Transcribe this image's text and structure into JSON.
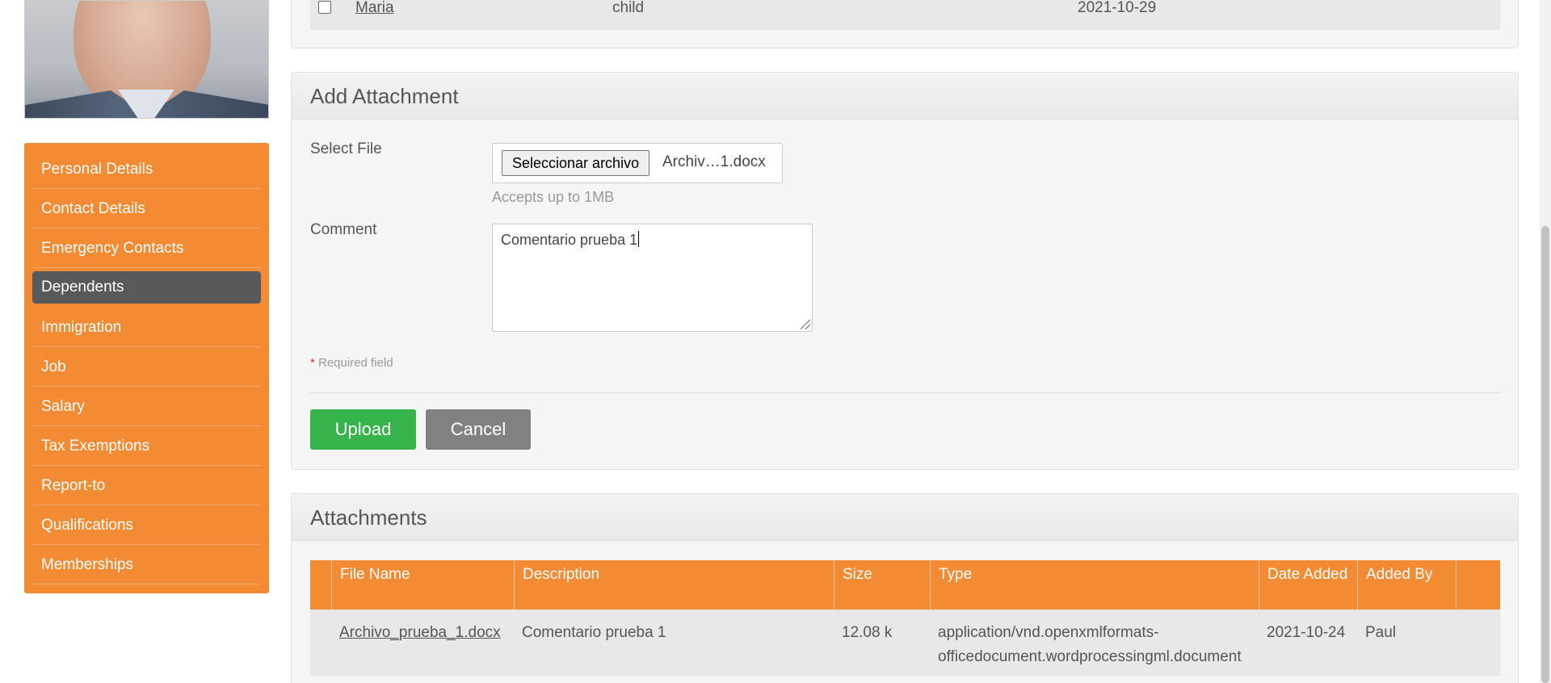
{
  "sidebar": {
    "items": [
      {
        "label": "Personal Details"
      },
      {
        "label": "Contact Details"
      },
      {
        "label": "Emergency Contacts"
      },
      {
        "label": "Dependents"
      },
      {
        "label": "Immigration"
      },
      {
        "label": "Job"
      },
      {
        "label": "Salary"
      },
      {
        "label": "Tax Exemptions"
      },
      {
        "label": "Report-to"
      },
      {
        "label": "Qualifications"
      },
      {
        "label": "Memberships"
      }
    ],
    "active_item": "Dependents",
    "color": "#f28b34",
    "active_color": "#58595b"
  },
  "dependents": {
    "row": {
      "name": "Maria",
      "relationship": "child",
      "date_of_birth": "2021-10-29"
    }
  },
  "add_attachment": {
    "title": "Add Attachment",
    "select_file_label": "Select File",
    "file_button_label": "Seleccionar archivo",
    "file_name": "Archiv…1.docx",
    "hint": "Accepts up to 1MB",
    "comment_label": "Comment",
    "comment_value": "Comentario prueba 1",
    "required_star": "*",
    "required_note": " Required field",
    "upload_label": "Upload",
    "cancel_label": "Cancel",
    "upload_color": "#36b34a",
    "cancel_color": "#818181"
  },
  "attachments": {
    "title": "Attachments",
    "headers": {
      "file_name": "File Name",
      "description": "Description",
      "size": "Size",
      "type": "Type",
      "date_added": "Date Added",
      "added_by": "Added By"
    },
    "rows": [
      {
        "file_name": "Archivo_prueba_1.docx",
        "description": "Comentario prueba 1",
        "size": "12.08 k",
        "type": "application/vnd.openxmlformats-officedocument.wordprocessingml.document",
        "date_added": "2021-10-24",
        "added_by": "Paul"
      }
    ]
  }
}
